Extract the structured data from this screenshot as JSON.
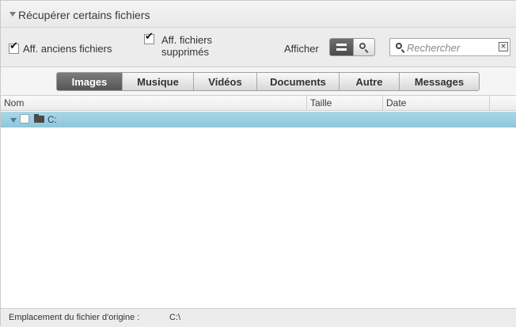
{
  "section": {
    "title": "Récupérer certains fichiers"
  },
  "options": {
    "show_old_label": "Aff. anciens fichiers",
    "show_old_checked": true,
    "show_deleted_label_line1": "Aff. fichiers",
    "show_deleted_label_line2": "supprimés",
    "show_deleted_checked": true,
    "view_label": "Afficher",
    "view_mode": "list"
  },
  "search": {
    "placeholder": "Rechercher",
    "clear_icon": "clear-icon"
  },
  "tabs": [
    {
      "label": "Images",
      "active": true
    },
    {
      "label": "Musique",
      "active": false
    },
    {
      "label": "Vidéos",
      "active": false
    },
    {
      "label": "Documents",
      "active": false
    },
    {
      "label": "Autre",
      "active": false
    },
    {
      "label": "Messages",
      "active": false
    }
  ],
  "table": {
    "columns": {
      "name": "Nom",
      "size": "Taille",
      "date": "Date"
    },
    "rows": [
      {
        "label": "C:",
        "expanded": true,
        "checked": false,
        "icon": "folder-icon"
      }
    ]
  },
  "status": {
    "label": "Emplacement du fichier d'origine :",
    "value": "C:\\"
  },
  "colors": {
    "selection": "#9fd0e2",
    "active_tab": "#606060"
  }
}
